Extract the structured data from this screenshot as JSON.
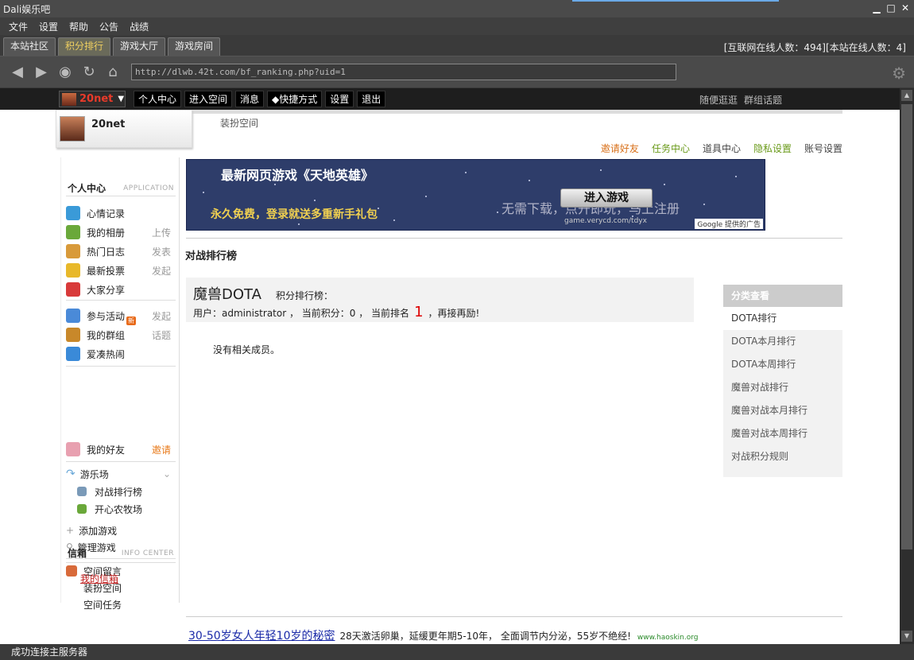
{
  "window": {
    "title": "Dali娱乐吧"
  },
  "menu": [
    "文件",
    "设置",
    "帮助",
    "公告",
    "战绩"
  ],
  "tabs": [
    {
      "label": "本站社区",
      "active": false
    },
    {
      "label": "积分排行",
      "active": true
    },
    {
      "label": "游戏大厅",
      "active": false
    },
    {
      "label": "游戏房间",
      "active": false
    }
  ],
  "online_status": "[互联网在线人数：494][本站在线人数：4]",
  "address": "http://dlwb.42t.com/bf_ranking.php?uid=1",
  "status_bar": "成功连接主服务器",
  "site_bar": {
    "username": "20net",
    "links": [
      "个人中心",
      "进入空间",
      "消息",
      "◆快捷方式",
      "设置",
      "退出"
    ],
    "right_links": [
      "随便逛逛",
      "群组话题"
    ]
  },
  "header": {
    "username": "20net",
    "dress_link": "装扮空间",
    "user_links": [
      {
        "label": "邀请好友",
        "color": "#d8701a"
      },
      {
        "label": "任务中心",
        "color": "#6a9a1a"
      },
      {
        "label": "道具中心",
        "color": "#444444"
      },
      {
        "label": "隐私设置",
        "color": "#6a9a1a"
      },
      {
        "label": "账号设置",
        "color": "#444444"
      }
    ]
  },
  "sidebar": {
    "title": "个人中心",
    "subtitle": "APPLICATION",
    "apps": [
      {
        "label": "心情记录",
        "extra": "",
        "color": "#3a9ad8"
      },
      {
        "label": "我的相册",
        "extra": "上传",
        "color": "#6aa83a"
      },
      {
        "label": "热门日志",
        "extra": "发表",
        "color": "#d89a3a"
      },
      {
        "label": "最新投票",
        "extra": "发起",
        "color": "#e8b82a"
      },
      {
        "label": "大家分享",
        "extra": "",
        "color": "#d83a3a"
      }
    ],
    "apps2": [
      {
        "label": "参与活动",
        "extra": "发起",
        "color": "#4a8ad8"
      },
      {
        "label": "我的群组",
        "extra": "话题",
        "color": "#c8882a"
      },
      {
        "label": "爱凑热闹",
        "extra": "",
        "color": "#3a8ad8"
      }
    ],
    "group_badge": "新",
    "friends": {
      "label": "我的好友",
      "extra": "邀请"
    },
    "playground": {
      "label": "游乐场",
      "items": [
        "对战排行榜",
        "开心农牧场"
      ]
    },
    "add_game": "添加游戏",
    "manage_game": "管理游戏",
    "space_links": [
      "空间留言",
      "装扮空间",
      "空间任务"
    ],
    "inbox_title": "信箱",
    "inbox_subtitle": "INFO CENTER",
    "my_inbox": "我的信箱"
  },
  "ad": {
    "headline": "最新网页游戏《天地英雄》",
    "subline": "永久免费，登录就送多重新手礼包",
    "button": "进入游戏",
    "slogan": "无需下载，点开即玩，马上注册",
    "url": "game.verycd.com/tdyx",
    "google": "Google 提供的广告"
  },
  "battle_title": "对战排行榜",
  "ranking": {
    "game": "魔兽DOTA",
    "subtitle": "积分排行榜：",
    "info_prefix": "用户：administrator ， 当前积分：0 ， 当前排名",
    "rank": "1",
    "info_suffix": "，再接再励!",
    "empty": "没有相关成员。"
  },
  "categories": {
    "title": "分类查看",
    "items": [
      "DOTA排行",
      "DOTA本月排行",
      "DOTA本周排行",
      "魔兽对战排行",
      "魔兽对战本月排行",
      "魔兽对战本周排行",
      "对战积分规则"
    ],
    "active_index": 0
  },
  "bottom_ad": {
    "link": "30-50岁女人年轻10岁的秘密",
    "text": "28天激活卵巢，延缓更年期5-10年， 全面调节内分泌，55岁不绝经!",
    "domain": "www.haoskin.org"
  }
}
